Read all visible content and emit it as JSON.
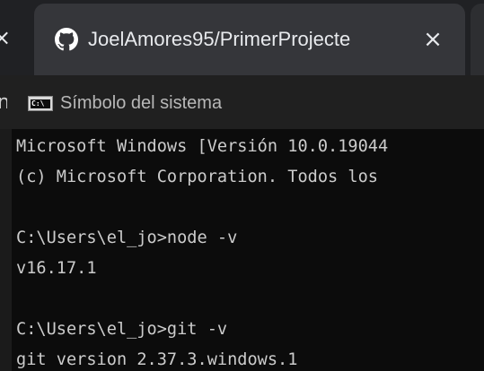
{
  "browser": {
    "prev_tab_close_glyph": "×",
    "active_tab": {
      "favicon": "github-icon",
      "title": "JoelAmores95/PrimerProjecte",
      "close_glyph": "×"
    }
  },
  "console_window": {
    "icon": "console-icon",
    "icon_text": "C:\\",
    "title_prefix_glyph": "n",
    "title": "Símbolo del sistema",
    "lines": [
      "Microsoft Windows [Versión 10.0.19044",
      "(c) Microsoft Corporation. Todos los",
      "",
      "C:\\Users\\el_jo>node -v",
      "v16.17.1",
      "",
      "C:\\Users\\el_jo>git -v",
      "git version 2.37.3.windows.1"
    ]
  },
  "colors": {
    "tab_active_bg": "#35363a",
    "tabstrip_bg": "#202124",
    "console_bg": "#0c0c0c",
    "console_text": "#cccccc",
    "title_text": "#b8b8b8"
  }
}
